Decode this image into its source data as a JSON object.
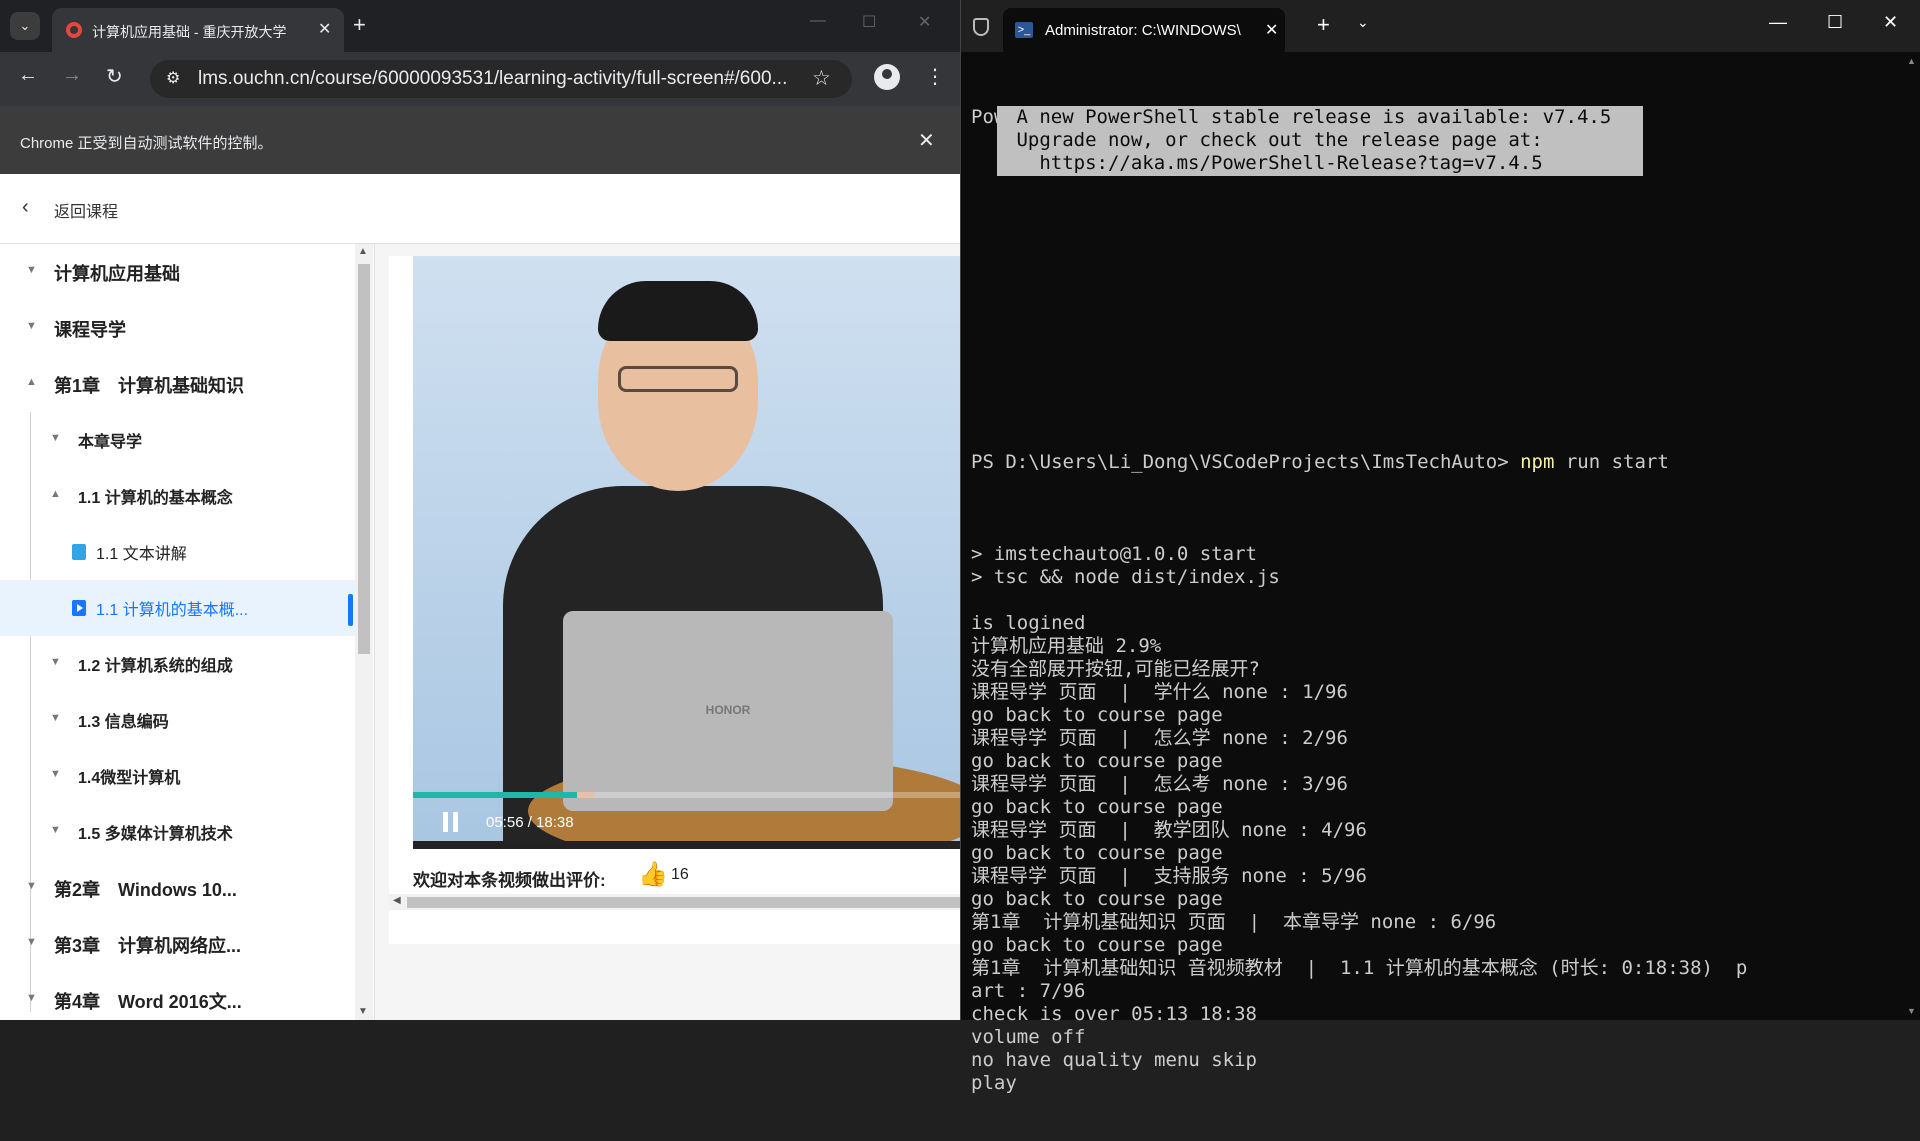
{
  "browser": {
    "tab_title": "计算机应用基础 - 重庆开放大学",
    "tab_close": "✕",
    "new_tab": "+",
    "url": "lms.ouchn.cn/course/60000093531/learning-activity/full-screen#/600...",
    "infobar_text": "Chrome 正受到自动测试软件的控制。",
    "infobar_close": "✕"
  },
  "page": {
    "back_label": "返回课程",
    "tree": [
      {
        "label": "计算机应用基础"
      },
      {
        "label": "课程导学"
      },
      {
        "label": "第1章　计算机基础知识"
      },
      {
        "label": "本章导学"
      },
      {
        "label": "1.1 计算机的基本概念"
      },
      {
        "label": "1.1 文本讲解"
      },
      {
        "label": "1.1 计算机的基本概..."
      },
      {
        "label": "1.2 计算机系统的组成"
      },
      {
        "label": "1.3 信息编码"
      },
      {
        "label": "1.4微型计算机"
      },
      {
        "label": "1.5 多媒体计算机技术"
      },
      {
        "label": "第2章　Windows 10..."
      },
      {
        "label": "第3章　计算机网络应..."
      },
      {
        "label": "第4章　Word 2016文..."
      }
    ],
    "video": {
      "time": "05:56 / 18:38",
      "progress": 0.3,
      "buffered": 0.33,
      "laptop_brand": "HONOR"
    },
    "rating_label": "欢迎对本条视频做出评价:",
    "like_count": "16"
  },
  "terminal": {
    "tab_title": "Administrator: C:\\WINDOWS\\",
    "lines_top": [
      "PowerShell 7.4.2"
    ],
    "notice": [
      " A new PowerShell stable release is available: v7.4.5 ",
      " Upgrade now, or check out the release page at:",
      "   https://aka.ms/PowerShell-Release?tag=v7.4.5"
    ],
    "prompt": "PS D:\\Users\\Li_Dong\\VSCodeProjects\\ImsTechAuto> ",
    "command": "npm",
    "command_args": " run start",
    "output": [
      "",
      "> imstechauto@1.0.0 start",
      "> tsc && node dist/index.js",
      "",
      "is logined",
      "计算机应用基础 2.9%",
      "没有全部展开按钮,可能已经展开?",
      "课程导学 页面  |  学什么 none : 1/96",
      "go back to course page",
      "课程导学 页面  |  怎么学 none : 2/96",
      "go back to course page",
      "课程导学 页面  |  怎么考 none : 3/96",
      "go back to course page",
      "课程导学 页面  |  教学团队 none : 4/96",
      "go back to course page",
      "课程导学 页面  |  支持服务 none : 5/96",
      "go back to course page",
      "第1章  计算机基础知识 页面  |  本章导学 none : 6/96",
      "go back to course page",
      "第1章  计算机基础知识 音视频教材  |  1.1 计算机的基本概念 (时长: 0:18:38)  p",
      "art : 7/96",
      "check is over 05:13 18:38",
      "volume off",
      "no have quality menu skip",
      "play"
    ]
  }
}
